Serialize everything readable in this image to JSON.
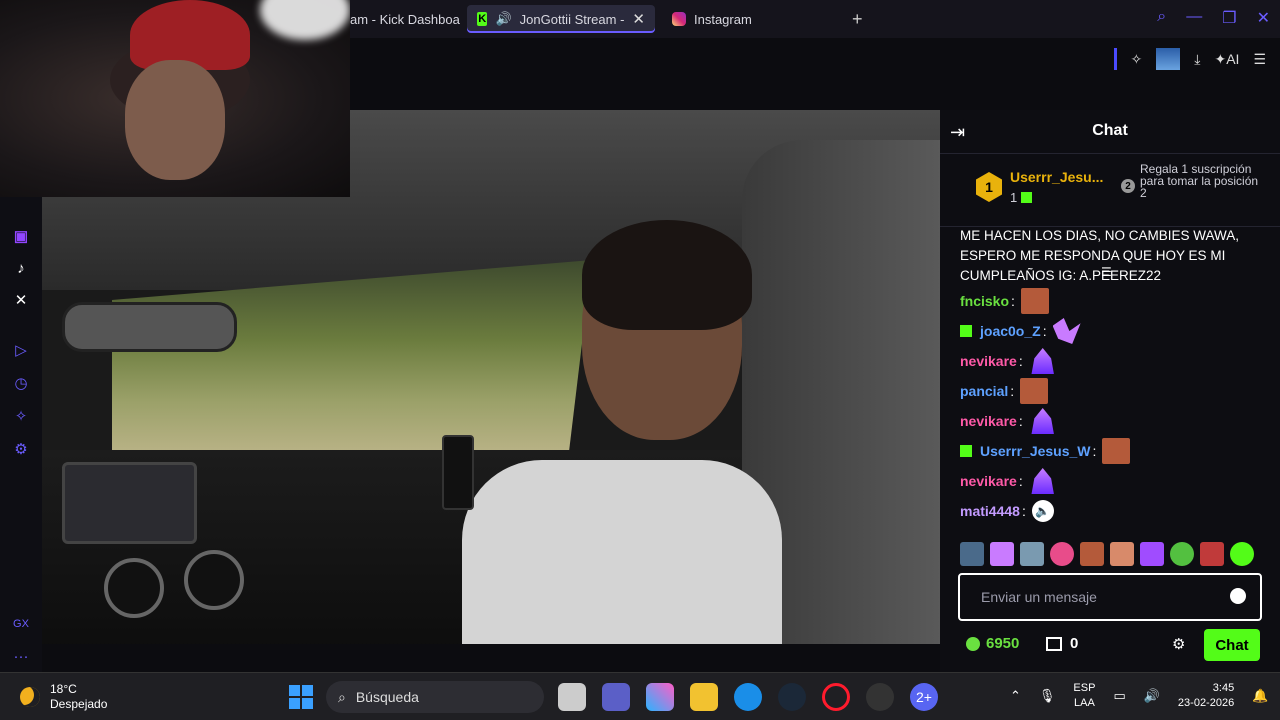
{
  "browser": {
    "tabs": [
      {
        "label": "am - Kick Dashboa"
      },
      {
        "label": "JonGottii Stream -"
      },
      {
        "label": "Instagram"
      }
    ],
    "close_glyph": "✕",
    "new_tab_glyph": "+"
  },
  "toolbar": {
    "ai_label": "AI"
  },
  "sidebar": {
    "icons": [
      "twitch-icon",
      "tiktok-icon",
      "x-icon",
      "player-icon",
      "history-icon",
      "extensions-icon",
      "settings-icon"
    ],
    "gx_label": "GX",
    "more_label": "···"
  },
  "chat": {
    "title": "Chat",
    "pinned": {
      "rank1": "1",
      "user": "Userrr_Jesu...",
      "count": "1",
      "rank2": "2",
      "rank2_text": "Regala 1 suscripción para tomar la posición 2"
    },
    "long_message": "ME HACEN LOS DIAS, NO CAMBIES WAWA, ESPERO ME RESPONDA QUE HOY ES MI CUMPLEAÑOS IG: A.PEEREZ22",
    "messages": [
      {
        "user": "fncisko",
        "color": "green",
        "badge": false,
        "emote": "face"
      },
      {
        "user": "joac0o_Z",
        "color": "blue",
        "badge": true,
        "emote": "wing"
      },
      {
        "user": "nevikare",
        "color": "pink",
        "badge": false,
        "emote": "purple"
      },
      {
        "user": "pancial",
        "color": "blue",
        "badge": false,
        "emote": "face"
      },
      {
        "user": "nevikare",
        "color": "pink",
        "badge": false,
        "emote": "purple"
      },
      {
        "user": "Userrr_Jesus_W",
        "color": "blue",
        "badge": true,
        "emote": "face"
      },
      {
        "user": "nevikare",
        "color": "pink",
        "badge": false,
        "emote": "purple"
      },
      {
        "user": "mati4448",
        "color": "lav",
        "badge": false,
        "emote": "sound"
      }
    ],
    "colon": ":",
    "input_placeholder": "Enviar un mensaje",
    "points": "6950",
    "store_count": "0",
    "chat_button": "Chat"
  },
  "taskbar": {
    "temperature": "18°C",
    "weather": "Despejado",
    "search_placeholder": "Búsqueda",
    "lang_top": "ESP",
    "lang_bottom": "LAA",
    "time": "3:45",
    "date": "23-02-2026",
    "discord_badge": "2+"
  },
  "colors": {
    "kick_green": "#53fc18",
    "opera_accent": "#6a5cff",
    "gold": "#e9b20c"
  }
}
